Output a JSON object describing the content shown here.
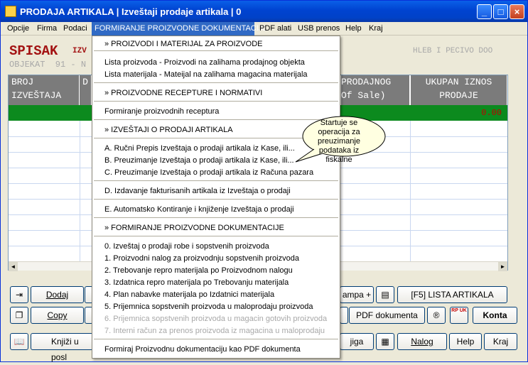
{
  "window": {
    "title": "PRODAJA ARTIKALA | Izveštaji prodaje artikala | 0",
    "minimize": "_",
    "maximize": "□",
    "close": "×"
  },
  "menu": [
    "Opcije",
    "Firma",
    "Podaci",
    "FORMIRANJE PROIZVODNE DOKUMENTACIJE",
    "PDF alati",
    "USB prenos",
    "Help",
    "Kraj"
  ],
  "header": {
    "spisak": "SPISAK",
    "izv": "IZV",
    "obj": "OBJEKAT  91 - N",
    "right": "HLEB I PECIVO DOO"
  },
  "grid": {
    "col1": [
      "BROJ",
      "IZVEŠTAJA"
    ],
    "col2": [
      "D",
      ""
    ],
    "col3": [
      "PRODAJNOG",
      "Of Sale)"
    ],
    "col4": [
      "UKUPAN IZNOS",
      "PRODAJE"
    ],
    "amount": "0.00",
    "left_arrow": "◄",
    "right_arrow": "►"
  },
  "buttons": {
    "dodaj": "Dodaj",
    "copy": "Copy",
    "knjizi": "Knjiži u posl",
    "campa": "ampa +",
    "lista": "[F5]  LISTA ARTIKALA",
    "pdf": "PDF dokumenta",
    "konta": "Konta",
    "jiga": "jiga",
    "nalog": "Nalog",
    "help": "Help",
    "kraj": "Kraj",
    "r": "®",
    "rpuk": "RP UK"
  },
  "dropdown": {
    "items": [
      {
        "t": "» PROIZVODI I MATERIJAL ZA PROIZVODE",
        "d": false
      },
      {
        "t": "Lista proizvoda - Proizvodi na zalihama prodajnog objekta",
        "d": false
      },
      {
        "t": "Lista materijala - Mateijal na zalihama magacina materijala",
        "d": false
      },
      {
        "t": "» PROIZVODNE RECEPTURE I NORMATIVI",
        "d": false
      },
      {
        "t": "Formiranje proizvodnih receptura",
        "d": false
      },
      {
        "t": "» IZVEŠTAJI O PRODAJI ARTIKALA",
        "d": false
      },
      {
        "t": "A. Ručni Prepis Izveštaja o prodaji artikala iz Kase, ili...",
        "d": false
      },
      {
        "t": "B. Preuzimanje Izveštaja o prodaji artikala iz Kase, ili...",
        "d": false
      },
      {
        "t": "C. Preuzimanje Izveštaja o prodaji artikala iz Računa pazara",
        "d": false
      },
      {
        "t": "D. Izdavanje fakturisanih artikala iz Izveštaja o prodaji",
        "d": false
      },
      {
        "t": "E. Automatsko Kontiranje i knjiženje Izveštaja o prodaji",
        "d": false
      },
      {
        "t": "» FORMIRANJE PROIZVODNE DOKUMENTACIJE",
        "d": false
      },
      {
        "t": "0. Izveštaj o prodaji robe i sopstvenih proizvoda",
        "d": false
      },
      {
        "t": "1. Proizvodni nalog za proizvodnju sopstvenih proizvoda",
        "d": false
      },
      {
        "t": "2. Trebovanje repro materijala po Proizvodnom nalogu",
        "d": false
      },
      {
        "t": "3. Izdatnica repro materijala po Trebovanju materijala",
        "d": false
      },
      {
        "t": "4. Plan nabavke materijala po Izdatnici materijala",
        "d": false
      },
      {
        "t": "5. Prijemnica sopstvenih proizvoda u maloprodaju proizvoda",
        "d": false
      },
      {
        "t": "6. Prijemnica sopstvenih proizvoda u magacin gotovih proizvoda",
        "d": true
      },
      {
        "t": "7. Interni račun za prenos proizvoda iz magacina u maloprodaju",
        "d": true
      },
      {
        "t": "Formiraj Proizvodnu dokumentaciju kao PDF dokumenta",
        "d": false
      }
    ]
  },
  "tooltip": "Startuje se operacija za preuzimanje podataka iz fiskalne",
  "colors": {
    "accent": "#316ac5",
    "green_row": "#0c8a1e",
    "header_red": "#a31313"
  }
}
